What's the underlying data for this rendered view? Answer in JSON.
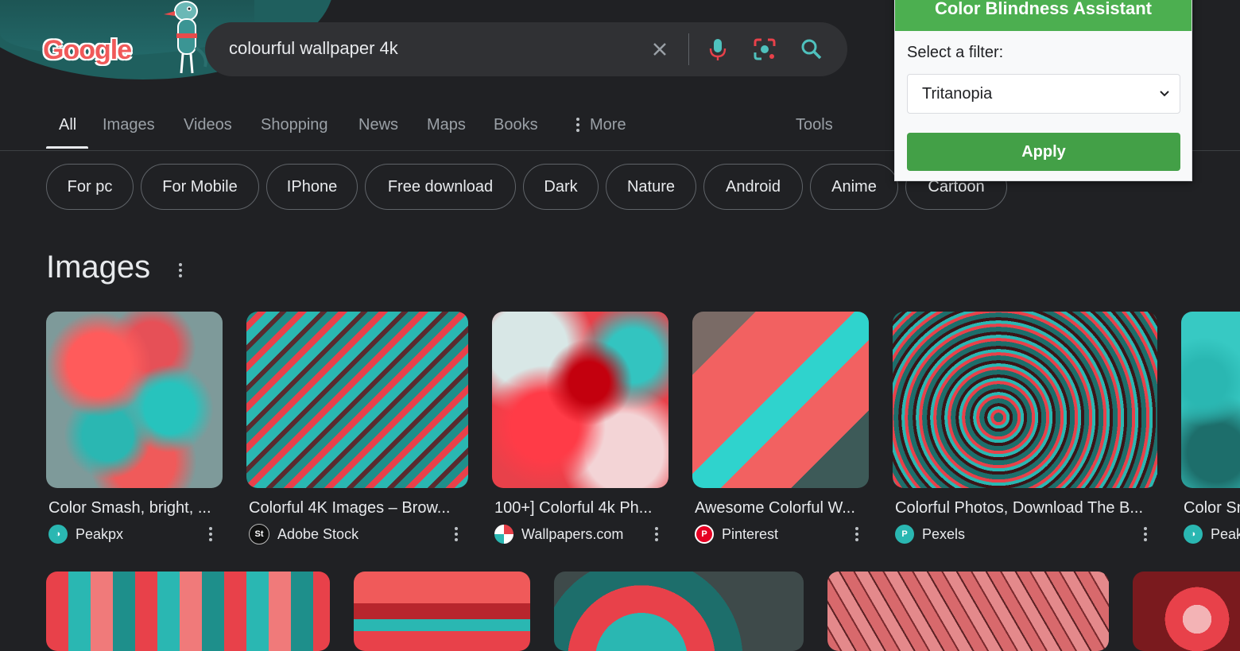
{
  "header": {
    "logo_text": "Google",
    "search": {
      "query": "colourful wallpaper 4k",
      "clear_icon": "close-icon",
      "voice_icon": "microphone-icon",
      "lens_icon": "lens-icon",
      "search_icon": "search-icon"
    }
  },
  "tabs": [
    {
      "label": "All",
      "active": true
    },
    {
      "label": "Images"
    },
    {
      "label": "Videos"
    },
    {
      "label": "Shopping"
    },
    {
      "label": "News"
    },
    {
      "label": "Maps"
    },
    {
      "label": "Books"
    },
    {
      "label": "More"
    },
    {
      "label": "Tools"
    }
  ],
  "chips": [
    "For pc",
    "For Mobile",
    "IPhone",
    "Free download",
    "Dark",
    "Nature",
    "Android",
    "Anime",
    "Cartoon"
  ],
  "images_section": {
    "title": "Images",
    "cards": [
      {
        "title": "Color Smash, bright, ...",
        "source": "Peakpx"
      },
      {
        "title": "Colorful 4K Images – Brow...",
        "source": "Adobe Stock"
      },
      {
        "title": "100+] Colorful 4k Ph...",
        "source": "Wallpapers.com"
      },
      {
        "title": "Awesome Colorful W...",
        "source": "Pinterest"
      },
      {
        "title": "Colorful Photos, Download The B...",
        "source": "Pexels"
      },
      {
        "title": "Color Sm",
        "source": "Peak"
      }
    ]
  },
  "popup": {
    "title": "Color Blindness Assistant",
    "label": "Select a filter:",
    "selected_filter": "Tritanopia",
    "apply_label": "Apply",
    "accent": "#4caf50"
  },
  "colors": {
    "background": "#202124",
    "search_bg": "#303134",
    "teal": "#2ab7b2",
    "red": "#e8414a"
  }
}
